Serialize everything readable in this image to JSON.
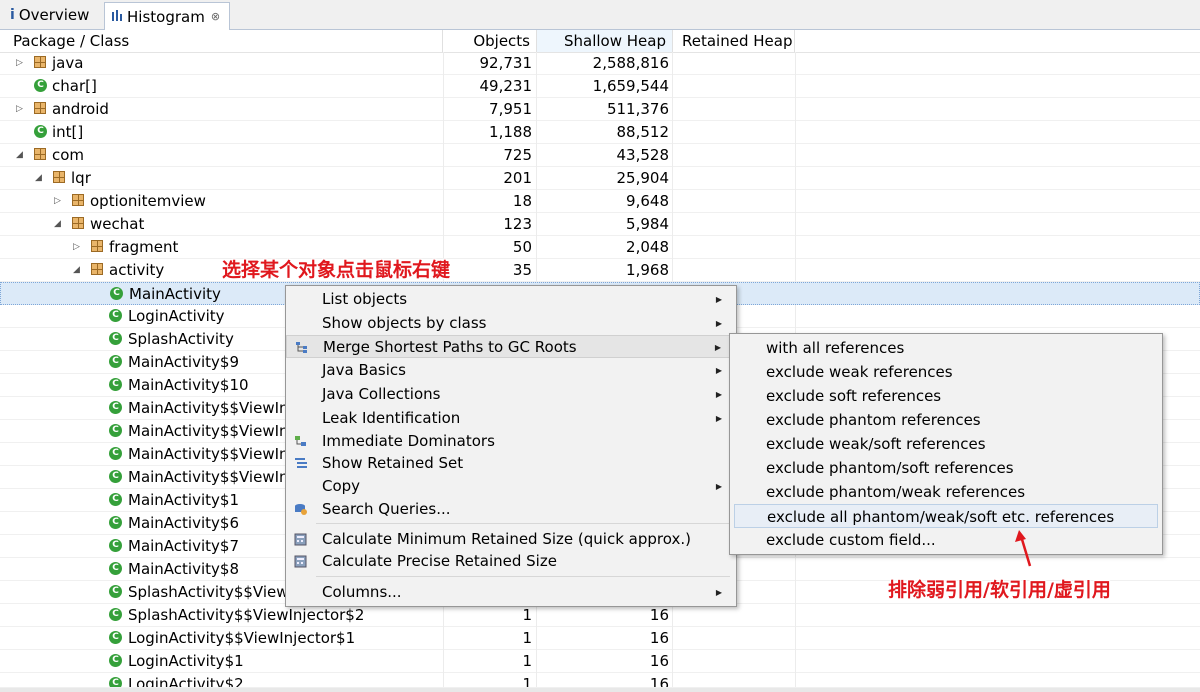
{
  "tabs": [
    {
      "label": "Overview",
      "icon": "info-icon"
    },
    {
      "label": "Histogram",
      "icon": "histogram-icon",
      "close": "⊗"
    }
  ],
  "columns": {
    "name": "Package / Class",
    "objects": "Objects",
    "shallow": "Shallow Heap",
    "retained": "Retained Heap"
  },
  "rows": [
    {
      "label": "java",
      "objects": "92,731",
      "shallow": "2,588,816"
    },
    {
      "label": "char[]",
      "objects": "49,231",
      "shallow": "1,659,544"
    },
    {
      "label": "android",
      "objects": "7,951",
      "shallow": "511,376"
    },
    {
      "label": "int[]",
      "objects": "1,188",
      "shallow": "88,512"
    },
    {
      "label": "com",
      "objects": "725",
      "shallow": "43,528"
    },
    {
      "label": "lqr",
      "objects": "201",
      "shallow": "25,904"
    },
    {
      "label": "optionitemview",
      "objects": "18",
      "shallow": "9,648"
    },
    {
      "label": "wechat",
      "objects": "123",
      "shallow": "5,984"
    },
    {
      "label": "fragment",
      "objects": "50",
      "shallow": "2,048"
    },
    {
      "label": "activity",
      "objects": "35",
      "shallow": "1,968"
    },
    {
      "label": "MainActivity",
      "objects": "",
      "shallow": ""
    },
    {
      "label": "LoginActivity",
      "objects": "",
      "shallow": ""
    },
    {
      "label": "SplashActivity",
      "objects": "",
      "shallow": ""
    },
    {
      "label": "MainActivity$9",
      "objects": "",
      "shallow": ""
    },
    {
      "label": "MainActivity$10",
      "objects": "",
      "shallow": ""
    },
    {
      "label": "MainActivity$$ViewIn",
      "objects": "",
      "shallow": ""
    },
    {
      "label": "MainActivity$$ViewIn",
      "objects": "",
      "shallow": ""
    },
    {
      "label": "MainActivity$$ViewIn",
      "objects": "",
      "shallow": ""
    },
    {
      "label": "MainActivity$$ViewIn",
      "objects": "",
      "shallow": ""
    },
    {
      "label": "MainActivity$1",
      "objects": "",
      "shallow": ""
    },
    {
      "label": "MainActivity$6",
      "objects": "",
      "shallow": ""
    },
    {
      "label": "MainActivity$7",
      "objects": "",
      "shallow": ""
    },
    {
      "label": "MainActivity$8",
      "objects": "",
      "shallow": ""
    },
    {
      "label": "SplashActivity$$View",
      "objects": "",
      "shallow": ""
    },
    {
      "label": "SplashActivity$$ViewInjector$2",
      "objects": "1",
      "shallow": "16"
    },
    {
      "label": "LoginActivity$$ViewInjector$1",
      "objects": "1",
      "shallow": "16"
    },
    {
      "label": "LoginActivity$1",
      "objects": "1",
      "shallow": "16"
    },
    {
      "label": "LoginActivity$2",
      "objects": "1",
      "shallow": "16"
    }
  ],
  "context_menu": {
    "items": [
      {
        "label": "List objects",
        "submenu": true
      },
      {
        "label": "Show objects by class",
        "submenu": true
      },
      {
        "label": "Merge Shortest Paths to GC Roots",
        "submenu": true,
        "icon": "merge-paths-icon"
      },
      {
        "label": "Java Basics",
        "submenu": true
      },
      {
        "label": "Java Collections",
        "submenu": true
      },
      {
        "label": "Leak Identification",
        "submenu": true
      },
      {
        "label": "Immediate Dominators",
        "submenu": false,
        "icon": "dominators-icon"
      },
      {
        "label": "Show Retained Set",
        "submenu": false,
        "icon": "retained-set-icon"
      },
      {
        "label": "Copy",
        "submenu": true
      },
      {
        "label": "Search Queries...",
        "submenu": false,
        "icon": "search-queries-icon"
      },
      {
        "label": "Calculate Minimum Retained Size (quick approx.)",
        "submenu": false,
        "icon": "calculator-icon"
      },
      {
        "label": "Calculate Precise Retained Size",
        "submenu": false,
        "icon": "calculator-icon"
      },
      {
        "label": "Columns...",
        "submenu": true
      }
    ]
  },
  "submenu": {
    "items": [
      {
        "label": "with all references"
      },
      {
        "label": "exclude weak references"
      },
      {
        "label": "exclude soft references"
      },
      {
        "label": "exclude phantom references"
      },
      {
        "label": "exclude weak/soft references"
      },
      {
        "label": "exclude phantom/soft references"
      },
      {
        "label": "exclude phantom/weak references"
      },
      {
        "label": "exclude all phantom/weak/soft etc. references"
      },
      {
        "label": "exclude custom field..."
      }
    ]
  },
  "annotations": {
    "right_click": "选择某个对象点击鼠标右键",
    "exclude_refs": "排除弱引用/软引用/虚引用"
  },
  "colors": {
    "annotation": "#e0181e",
    "selection": "#dceaf8",
    "class_icon": "#35a03a",
    "package_icon": "#e9b56a"
  }
}
